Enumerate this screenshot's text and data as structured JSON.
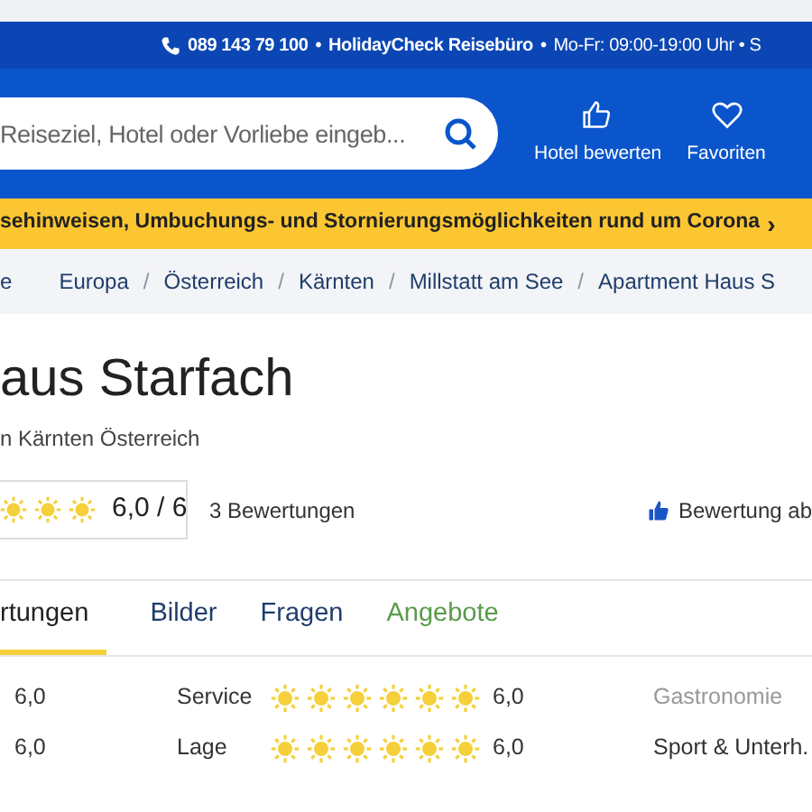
{
  "top_bar": {
    "phone": "089 143 79 100",
    "separator_1": "•",
    "agency": "HolidayCheck Reisebüro",
    "separator_2": "•",
    "hours": "Mo-Fr: 09:00-19:00 Uhr • S"
  },
  "search": {
    "placeholder": "Reiseziel, Hotel oder Vorliebe eingeb..."
  },
  "header_actions": [
    {
      "kind": "rate",
      "label": "Hotel bewerten"
    },
    {
      "kind": "favorites",
      "label": "Favoriten"
    }
  ],
  "banner": {
    "text": "sehinweisen, Umbuchungs- und Stornierungsmöglichkeiten rund um Corona",
    "chevron": "›"
  },
  "breadcrumb": [
    {
      "label": "e"
    },
    {
      "label": "Europa"
    },
    {
      "separator": "/",
      "label": "Österreich"
    },
    {
      "separator": "/",
      "label": "Kärnten"
    },
    {
      "separator": "/",
      "label": "Millstatt am See"
    },
    {
      "separator": "/",
      "label": "Apartment Haus S"
    }
  ],
  "hotel": {
    "title": "aus Starfach",
    "location": "n Kärnten Österreich",
    "stars": 3,
    "score": "6,0 / 6",
    "reviews": "3 Bewertungen",
    "write_review": "Bewertung ab"
  },
  "tabs": [
    {
      "label": "rtungen",
      "kind": "section",
      "selected": true
    },
    {
      "label": "Bilder",
      "kind": "section",
      "selected": false
    },
    {
      "label": "Fragen",
      "kind": "section",
      "selected": false
    },
    {
      "label": "Angebote",
      "kind": "offer",
      "selected": false
    }
  ],
  "ratings": [
    {
      "value_1": "6,0",
      "label": "Service",
      "stars": 6,
      "value_2": "6,0",
      "label_3": "Gastronomie",
      "dimmed": true
    },
    {
      "value_1": "6,0",
      "label": "Lage",
      "stars": 6,
      "value_2": "6,0",
      "label_3": "Sport & Unterh.",
      "dimmed": false
    }
  ]
}
